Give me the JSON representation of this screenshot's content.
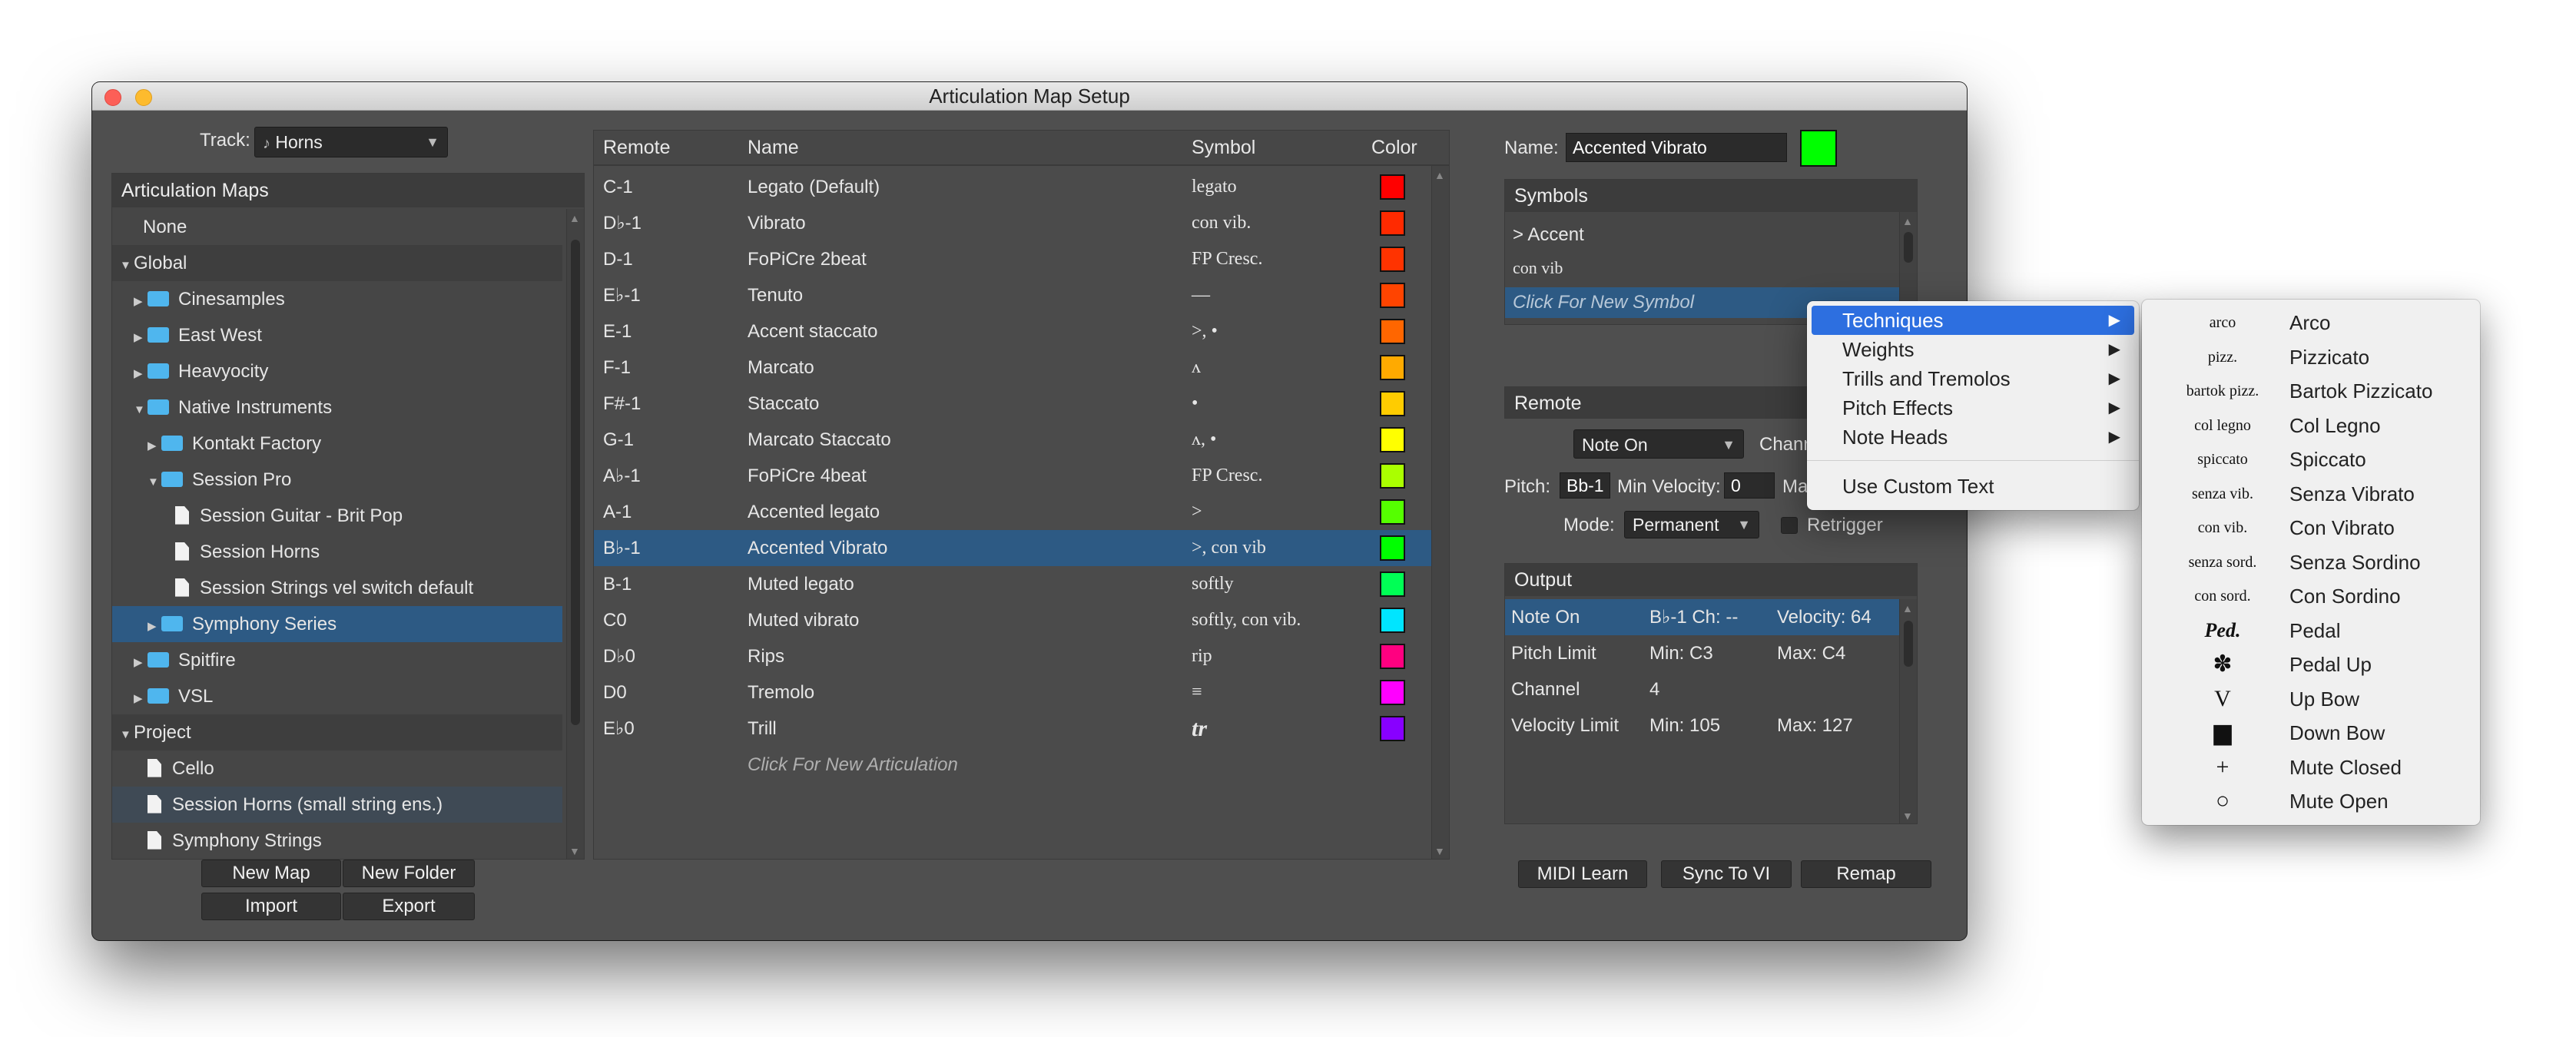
{
  "window": {
    "title": "Articulation Map Setup"
  },
  "track": {
    "label": "Track:",
    "value": "Horns"
  },
  "maps": {
    "header": "Articulation Maps",
    "tree": [
      {
        "label": "None",
        "kind": "plain",
        "indent": 0
      },
      {
        "label": "Global",
        "kind": "group",
        "indent": 0,
        "disc": "▼"
      },
      {
        "label": "Cinesamples",
        "kind": "folder",
        "indent": 1,
        "disc": "▶"
      },
      {
        "label": "East West",
        "kind": "folder",
        "indent": 1,
        "disc": "▶"
      },
      {
        "label": "Heavyocity",
        "kind": "folder",
        "indent": 1,
        "disc": "▶"
      },
      {
        "label": "Native Instruments",
        "kind": "folder",
        "indent": 1,
        "disc": "▼"
      },
      {
        "label": "Kontakt Factory",
        "kind": "folder",
        "indent": 2,
        "disc": "▶"
      },
      {
        "label": "Session Pro",
        "kind": "folder",
        "indent": 2,
        "disc": "▼"
      },
      {
        "label": "Session Guitar - Brit Pop",
        "kind": "doc",
        "indent": 3
      },
      {
        "label": "Session Horns",
        "kind": "doc",
        "indent": 3
      },
      {
        "label": "Session Strings vel switch default",
        "kind": "doc",
        "indent": 3
      },
      {
        "label": "Symphony Series",
        "kind": "folder",
        "indent": 2,
        "disc": "▶",
        "state": "sel"
      },
      {
        "label": "Spitfire",
        "kind": "folder",
        "indent": 1,
        "disc": "▶"
      },
      {
        "label": "VSL",
        "kind": "folder",
        "indent": 1,
        "disc": "▶"
      },
      {
        "label": "Project",
        "kind": "group",
        "indent": 0,
        "disc": "▼"
      },
      {
        "label": "Cello",
        "kind": "doc",
        "indent": 1
      },
      {
        "label": "Session Horns (small string ens.)",
        "kind": "doc",
        "indent": 1,
        "state": "light"
      },
      {
        "label": "Symphony Strings",
        "kind": "doc",
        "indent": 1
      }
    ],
    "buttons": {
      "new_map": "New Map",
      "new_folder": "New Folder",
      "import": "Import",
      "export": "Export"
    }
  },
  "articulations": {
    "columns": {
      "remote": "Remote",
      "name": "Name",
      "symbol": "Symbol",
      "color": "Color"
    },
    "rows": [
      {
        "remote": "C-1",
        "name": "Legato (Default)",
        "symbol": "legato",
        "color": "#ff0000"
      },
      {
        "remote": "D♭-1",
        "name": "Vibrato",
        "symbol": "con vib.",
        "color": "#ff2a00"
      },
      {
        "remote": "D-1",
        "name": "FoPiCre 2beat",
        "symbol": "FP Cresc.",
        "color": "#ff3300"
      },
      {
        "remote": "E♭-1",
        "name": "Tenuto",
        "symbol": "—",
        "color": "#ff4400"
      },
      {
        "remote": "E-1",
        "name": "Accent staccato",
        "symbol": ">, •",
        "color": "#ff6600"
      },
      {
        "remote": "F-1",
        "name": "Marcato",
        "symbol": "ʌ",
        "color": "#ffaa00"
      },
      {
        "remote": "F#-1",
        "name": "Staccato",
        "symbol": "•",
        "color": "#ffcc00"
      },
      {
        "remote": "G-1",
        "name": "Marcato Staccato",
        "symbol": "ʌ, •",
        "color": "#ffff00"
      },
      {
        "remote": "A♭-1",
        "name": "FoPiCre 4beat",
        "symbol": "FP Cresc.",
        "color": "#aaff00"
      },
      {
        "remote": "A-1",
        "name": "Accented legato",
        "symbol": ">",
        "color": "#55ff00"
      },
      {
        "remote": "B♭-1",
        "name": "Accented Vibrato",
        "symbol": ">, con vib",
        "color": "#00ff00",
        "selected": true
      },
      {
        "remote": "B-1",
        "name": "Muted legato",
        "symbol": "softly",
        "color": "#00ff55"
      },
      {
        "remote": "C0",
        "name": "Muted vibrato",
        "symbol": "softly, con vib.",
        "color": "#00e5ff"
      },
      {
        "remote": "D♭0",
        "name": "Rips",
        "symbol": "rip",
        "color": "#ff0080"
      },
      {
        "remote": "D0",
        "name": "Tremolo",
        "symbol": "≡",
        "color": "#ff00ff"
      },
      {
        "remote": "E♭0",
        "name": "Trill",
        "symbol": "tr",
        "color": "#8800ff"
      }
    ],
    "new_placeholder": "Click For New Articulation"
  },
  "editor": {
    "name_label": "Name:",
    "name_value": "Accented Vibrato",
    "name_color": "#00ff00",
    "symbols": {
      "header": "Symbols",
      "items": [
        ">  Accent",
        "con vib"
      ],
      "new_placeholder": "Click For New Symbol"
    },
    "remote": {
      "header": "Remote",
      "type": "Note On",
      "channel_label": "Chann",
      "pitch_label": "Pitch:",
      "pitch_value": "Bb-1",
      "min_vel_label": "Min Velocity:",
      "min_vel_value": "0",
      "max_label": "Ma",
      "mode_label": "Mode:",
      "mode_value": "Permanent",
      "retrigger_label": "Retrigger"
    },
    "output": {
      "header": "Output",
      "rows": [
        {
          "c1": "Note On",
          "c2": "B♭-1   Ch: --",
          "c3": "Velocity: 64",
          "selected": true
        },
        {
          "c1": "Pitch Limit",
          "c2": "Min: C3",
          "c3": "Max: C4"
        },
        {
          "c1": "Channel",
          "c2": "4",
          "c3": ""
        },
        {
          "c1": "Velocity Limit",
          "c2": "Min: 105",
          "c3": "Max: 127"
        }
      ]
    },
    "buttons": {
      "midi_learn": "MIDI Learn",
      "sync": "Sync To VI",
      "remap": "Remap"
    }
  },
  "context_menu": {
    "items": [
      "Techniques",
      "Weights",
      "Trills and Tremolos",
      "Pitch Effects",
      "Note Heads"
    ],
    "custom": "Use Custom Text"
  },
  "techniques_menu": {
    "items": [
      {
        "sym": "arco",
        "name": "Arco"
      },
      {
        "sym": "pizz.",
        "name": "Pizzicato"
      },
      {
        "sym": "bartok pizz.",
        "name": "Bartok Pizzicato"
      },
      {
        "sym": "col legno",
        "name": "Col Legno"
      },
      {
        "sym": "spiccato",
        "name": "Spiccato"
      },
      {
        "sym": "senza vib.",
        "name": "Senza Vibrato"
      },
      {
        "sym": "con vib.",
        "name": "Con Vibrato"
      },
      {
        "sym": "senza sord.",
        "name": "Senza Sordino"
      },
      {
        "sym": "con sord.",
        "name": "Con Sordino"
      },
      {
        "sym": "Ped.",
        "name": "Pedal"
      },
      {
        "sym": "✽",
        "name": "Pedal Up"
      },
      {
        "sym": "V",
        "name": "Up Bow"
      },
      {
        "sym": "▆",
        "name": "Down Bow"
      },
      {
        "sym": "+",
        "name": "Mute Closed"
      },
      {
        "sym": "○",
        "name": "Mute Open"
      }
    ]
  }
}
